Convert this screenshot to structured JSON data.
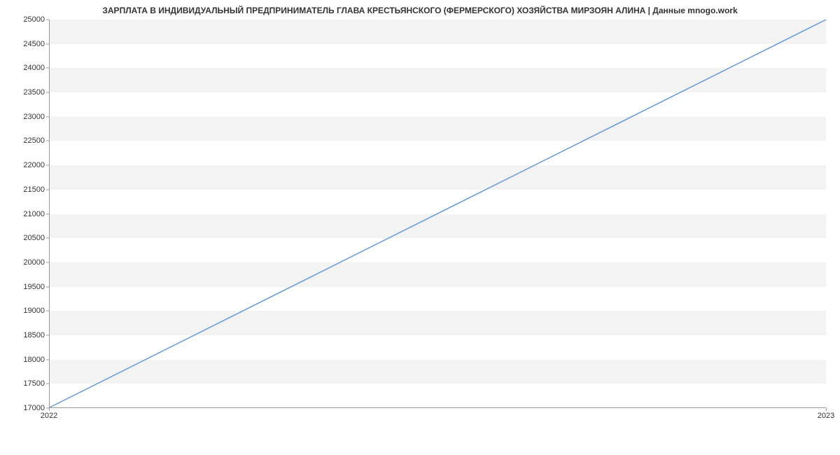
{
  "chart_data": {
    "type": "line",
    "title": "ЗАРПЛАТА В ИНДИВИДУАЛЬНЫЙ ПРЕДПРИНИМАТЕЛЬ ГЛАВА КРЕСТЬЯНСКОГО (ФЕРМЕРСКОГО) ХОЗЯЙСТВА МИРЗОЯН АЛИНА | Данные mnogo.work",
    "x": [
      "2022",
      "2023"
    ],
    "values": [
      17000,
      25000
    ],
    "xlabel": "",
    "ylabel": "",
    "ylim": [
      17000,
      25000
    ],
    "y_ticks": [
      17000,
      17500,
      18000,
      18500,
      19000,
      19500,
      20000,
      20500,
      21000,
      21500,
      22000,
      22500,
      23000,
      23500,
      24000,
      24500,
      25000
    ],
    "line_color": "#6699d8"
  }
}
